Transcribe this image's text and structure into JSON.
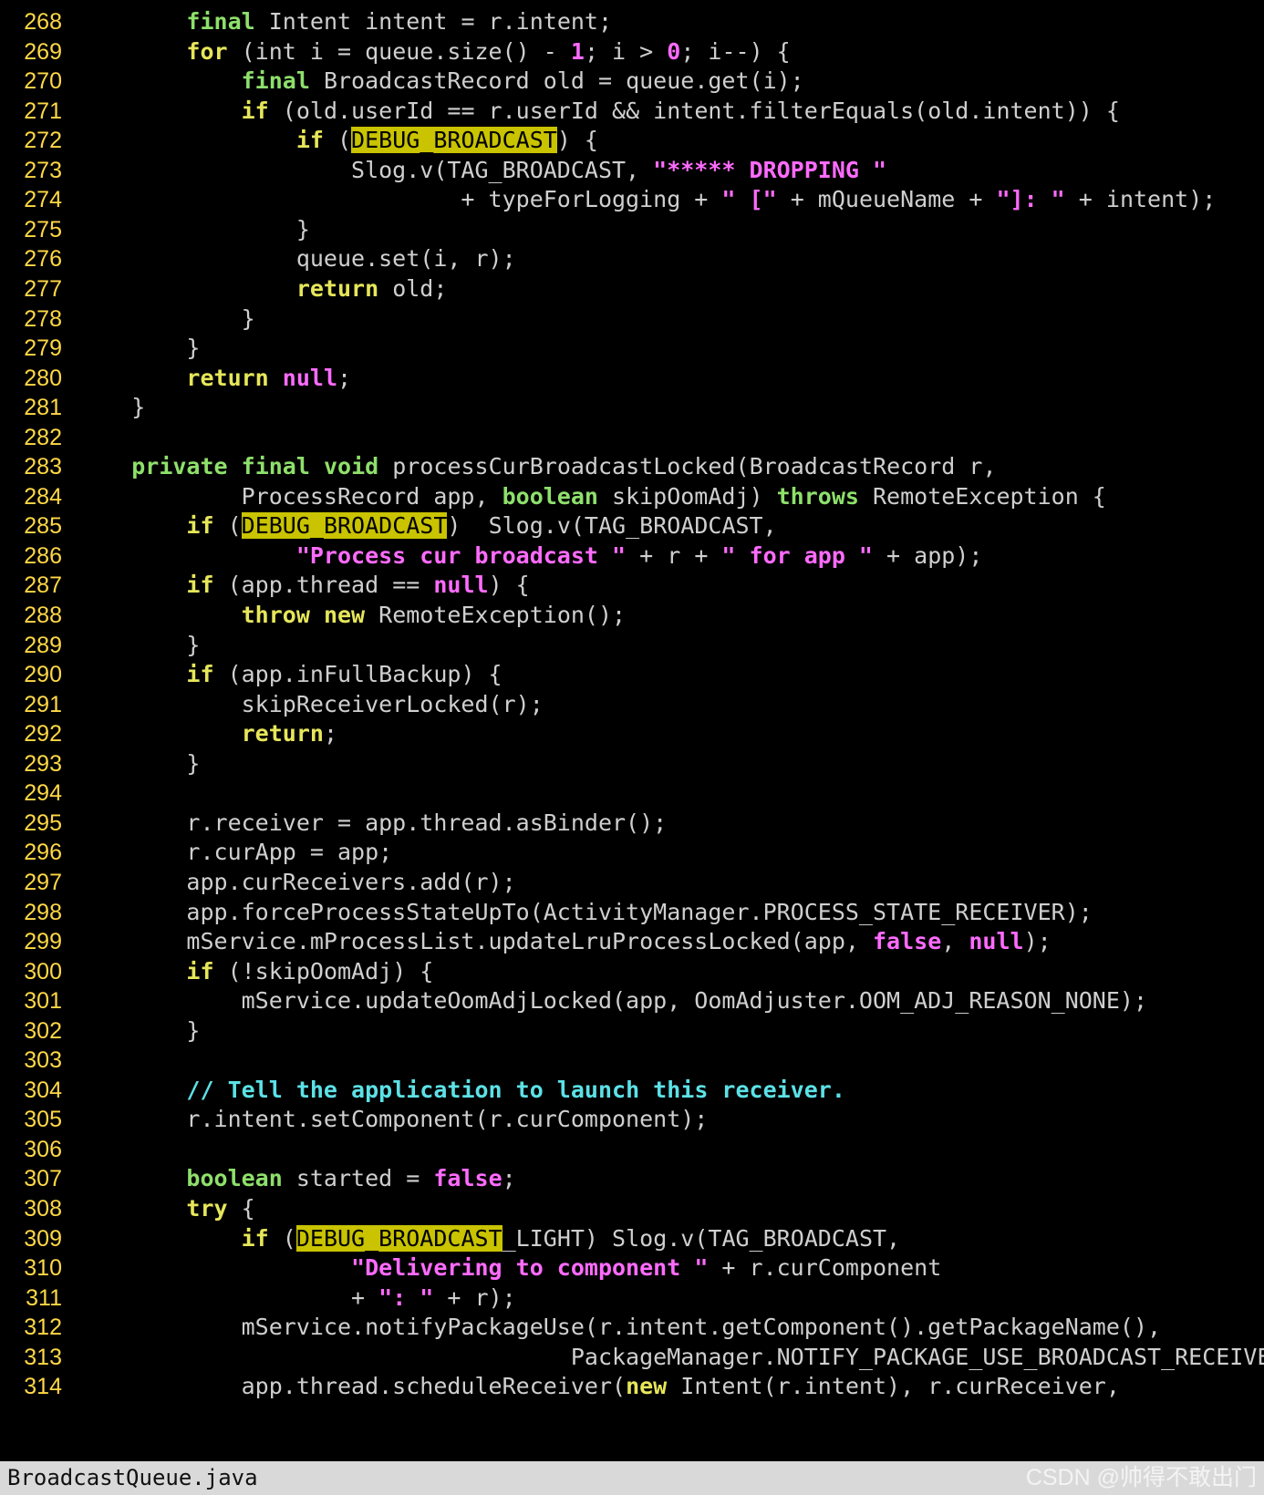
{
  "editor": {
    "lines": [
      {
        "n": "268",
        "t": [
          [
            "        ",
            "txt"
          ],
          [
            "final",
            "type"
          ],
          [
            " Intent intent = r.intent;",
            "txt"
          ]
        ]
      },
      {
        "n": "269",
        "t": [
          [
            "        ",
            "txt"
          ],
          [
            "for",
            "kw"
          ],
          [
            " (int i = queue.size() - ",
            "txt"
          ],
          [
            "1",
            "num"
          ],
          [
            "; i > ",
            "txt"
          ],
          [
            "0",
            "num"
          ],
          [
            "; i--) {",
            "txt"
          ]
        ]
      },
      {
        "n": "270",
        "t": [
          [
            "            ",
            "txt"
          ],
          [
            "final",
            "type"
          ],
          [
            " BroadcastRecord old = queue.get(i);",
            "txt"
          ]
        ]
      },
      {
        "n": "271",
        "t": [
          [
            "            ",
            "txt"
          ],
          [
            "if",
            "kw"
          ],
          [
            " (old.userId == r.userId && intent.filterEquals(old.intent)) {",
            "txt"
          ]
        ]
      },
      {
        "n": "272",
        "t": [
          [
            "                ",
            "txt"
          ],
          [
            "if",
            "kw"
          ],
          [
            " (",
            "txt"
          ],
          [
            "DEBUG_BROADCAST",
            "hl"
          ],
          [
            ") {",
            "txt"
          ]
        ]
      },
      {
        "n": "273",
        "t": [
          [
            "                    Slog.v(TAG_BROADCAST, ",
            "txt"
          ],
          [
            "\"***** DROPPING \"",
            "str"
          ]
        ]
      },
      {
        "n": "274",
        "t": [
          [
            "                            + typeForLogging + ",
            "txt"
          ],
          [
            "\" [\"",
            "str"
          ],
          [
            " + mQueueName + ",
            "txt"
          ],
          [
            "\"]: \"",
            "str"
          ],
          [
            " + intent);",
            "txt"
          ]
        ]
      },
      {
        "n": "275",
        "t": [
          [
            "                }",
            "txt"
          ]
        ]
      },
      {
        "n": "276",
        "t": [
          [
            "                queue.set(i, r);",
            "txt"
          ]
        ]
      },
      {
        "n": "277",
        "t": [
          [
            "                ",
            "txt"
          ],
          [
            "return",
            "kw"
          ],
          [
            " old;",
            "txt"
          ]
        ]
      },
      {
        "n": "278",
        "t": [
          [
            "            }",
            "txt"
          ]
        ]
      },
      {
        "n": "279",
        "t": [
          [
            "        }",
            "txt"
          ]
        ]
      },
      {
        "n": "280",
        "t": [
          [
            "        ",
            "txt"
          ],
          [
            "return",
            "kw"
          ],
          [
            " ",
            "txt"
          ],
          [
            "null",
            "num"
          ],
          [
            ";",
            "txt"
          ]
        ]
      },
      {
        "n": "281",
        "t": [
          [
            "    }",
            "txt"
          ]
        ]
      },
      {
        "n": "282",
        "t": []
      },
      {
        "n": "283",
        "t": [
          [
            "    ",
            "txt"
          ],
          [
            "private",
            "type"
          ],
          [
            " ",
            "txt"
          ],
          [
            "final",
            "type"
          ],
          [
            " ",
            "txt"
          ],
          [
            "void",
            "type"
          ],
          [
            " processCurBroadcastLocked(BroadcastRecord r,",
            "txt"
          ]
        ]
      },
      {
        "n": "284",
        "t": [
          [
            "            ProcessRecord app, ",
            "txt"
          ],
          [
            "boolean",
            "type"
          ],
          [
            " skipOomAdj) ",
            "txt"
          ],
          [
            "throws",
            "type"
          ],
          [
            " RemoteException {",
            "txt"
          ]
        ]
      },
      {
        "n": "285",
        "t": [
          [
            "        ",
            "txt"
          ],
          [
            "if",
            "kw"
          ],
          [
            " (",
            "txt"
          ],
          [
            "DEBUG_BROADCAST",
            "hl"
          ],
          [
            ")  Slog.v(TAG_BROADCAST,",
            "txt"
          ]
        ]
      },
      {
        "n": "286",
        "t": [
          [
            "                ",
            "txt"
          ],
          [
            "\"Process cur broadcast \"",
            "str"
          ],
          [
            " + r + ",
            "txt"
          ],
          [
            "\" for app \"",
            "str"
          ],
          [
            " + app);",
            "txt"
          ]
        ]
      },
      {
        "n": "287",
        "t": [
          [
            "        ",
            "txt"
          ],
          [
            "if",
            "kw"
          ],
          [
            " (app.thread == ",
            "txt"
          ],
          [
            "null",
            "num"
          ],
          [
            ") {",
            "txt"
          ]
        ]
      },
      {
        "n": "288",
        "t": [
          [
            "            ",
            "txt"
          ],
          [
            "throw",
            "kw"
          ],
          [
            " ",
            "txt"
          ],
          [
            "new",
            "kw"
          ],
          [
            " RemoteException();",
            "txt"
          ]
        ]
      },
      {
        "n": "289",
        "t": [
          [
            "        }",
            "txt"
          ]
        ]
      },
      {
        "n": "290",
        "t": [
          [
            "        ",
            "txt"
          ],
          [
            "if",
            "kw"
          ],
          [
            " (app.inFullBackup) {",
            "txt"
          ]
        ]
      },
      {
        "n": "291",
        "t": [
          [
            "            skipReceiverLocked(r);",
            "txt"
          ]
        ]
      },
      {
        "n": "292",
        "t": [
          [
            "            ",
            "txt"
          ],
          [
            "return",
            "kw"
          ],
          [
            ";",
            "txt"
          ]
        ]
      },
      {
        "n": "293",
        "t": [
          [
            "        }",
            "txt"
          ]
        ]
      },
      {
        "n": "294",
        "t": []
      },
      {
        "n": "295",
        "t": [
          [
            "        r.receiver = app.thread.asBinder();",
            "txt"
          ]
        ]
      },
      {
        "n": "296",
        "t": [
          [
            "        r.curApp = app;",
            "txt"
          ]
        ]
      },
      {
        "n": "297",
        "t": [
          [
            "        app.curReceivers.add(r);",
            "txt"
          ]
        ]
      },
      {
        "n": "298",
        "t": [
          [
            "        app.forceProcessStateUpTo(ActivityManager.PROCESS_STATE_RECEIVER);",
            "txt"
          ]
        ]
      },
      {
        "n": "299",
        "t": [
          [
            "        mService.mProcessList.updateLruProcessLocked(app, ",
            "txt"
          ],
          [
            "false",
            "num"
          ],
          [
            ", ",
            "txt"
          ],
          [
            "null",
            "num"
          ],
          [
            ");",
            "txt"
          ]
        ]
      },
      {
        "n": "300",
        "t": [
          [
            "        ",
            "txt"
          ],
          [
            "if",
            "kw"
          ],
          [
            " (!skipOomAdj) {",
            "txt"
          ]
        ]
      },
      {
        "n": "301",
        "t": [
          [
            "            mService.updateOomAdjLocked(app, OomAdjuster.OOM_ADJ_REASON_NONE);",
            "txt"
          ]
        ]
      },
      {
        "n": "302",
        "t": [
          [
            "        }",
            "txt"
          ]
        ]
      },
      {
        "n": "303",
        "t": []
      },
      {
        "n": "304",
        "t": [
          [
            "        ",
            "txt"
          ],
          [
            "// Tell the application to launch this receiver.",
            "cm"
          ]
        ]
      },
      {
        "n": "305",
        "t": [
          [
            "        r.intent.setComponent(r.curComponent);",
            "txt"
          ]
        ]
      },
      {
        "n": "306",
        "t": []
      },
      {
        "n": "307",
        "t": [
          [
            "        ",
            "txt"
          ],
          [
            "boolean",
            "type"
          ],
          [
            " started = ",
            "txt"
          ],
          [
            "false",
            "num"
          ],
          [
            ";",
            "txt"
          ]
        ]
      },
      {
        "n": "308",
        "t": [
          [
            "        ",
            "txt"
          ],
          [
            "try",
            "kw"
          ],
          [
            " {",
            "txt"
          ]
        ]
      },
      {
        "n": "309",
        "t": [
          [
            "            ",
            "txt"
          ],
          [
            "if",
            "kw"
          ],
          [
            " (",
            "txt"
          ],
          [
            "DEBUG_BROADCAST",
            "hl"
          ],
          [
            "_LIGHT) Slog.v(TAG_BROADCAST,",
            "txt"
          ]
        ]
      },
      {
        "n": "310",
        "t": [
          [
            "                    ",
            "txt"
          ],
          [
            "\"Delivering to component \"",
            "str"
          ],
          [
            " + r.curComponent",
            "txt"
          ]
        ]
      },
      {
        "n": "311",
        "t": [
          [
            "                    + ",
            "txt"
          ],
          [
            "\": \"",
            "str"
          ],
          [
            " + r);",
            "txt"
          ]
        ]
      },
      {
        "n": "312",
        "t": [
          [
            "            mService.notifyPackageUse(r.intent.getComponent().getPackageName(),",
            "txt"
          ]
        ]
      },
      {
        "n": "313",
        "t": [
          [
            "                                    PackageManager.NOTIFY_PACKAGE_USE_BROADCAST_RECEIVER);",
            "txt"
          ]
        ]
      },
      {
        "n": "314",
        "t": [
          [
            "            app.thread.scheduleReceiver(",
            "txt"
          ],
          [
            "new",
            "kw"
          ],
          [
            " Intent(r.intent), r.curReceiver,",
            "txt"
          ]
        ]
      }
    ]
  },
  "status": {
    "filename": "BroadcastQueue.java"
  },
  "watermark": {
    "text": "CSDN @帅得不敢出门"
  },
  "colors": {
    "background": "#000000",
    "line_number": "#ffd845",
    "keyword": "#e6e65a",
    "type": "#8ee06b",
    "string": "#ff6bff",
    "comment": "#5ce1e6",
    "highlight": "#c9c300"
  }
}
